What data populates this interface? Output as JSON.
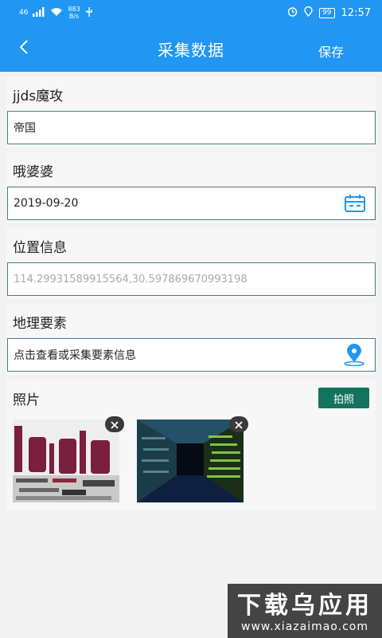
{
  "status": {
    "network": "46",
    "speed_value": "883",
    "speed_unit": "B/s",
    "battery": "99",
    "time": "12:57"
  },
  "header": {
    "title": "采集数据",
    "save_label": "保存"
  },
  "fields": [
    {
      "label": "jjds魔攻",
      "value": "帝国"
    },
    {
      "label": "哦婆婆",
      "value": "2019-09-20"
    },
    {
      "label": "位置信息",
      "value": "114.29931589915564,30.597869670993198"
    },
    {
      "label": "地理要素",
      "value": "点击查看或采集要素信息"
    }
  ],
  "photos": {
    "label": "照片",
    "button": "拍照"
  },
  "colors": {
    "primary": "#2196f3",
    "button": "#13735e",
    "border": "#4a7a8a"
  },
  "watermark": {
    "top": "下载乌应用",
    "bottom": "www.xiazaimao.com"
  }
}
